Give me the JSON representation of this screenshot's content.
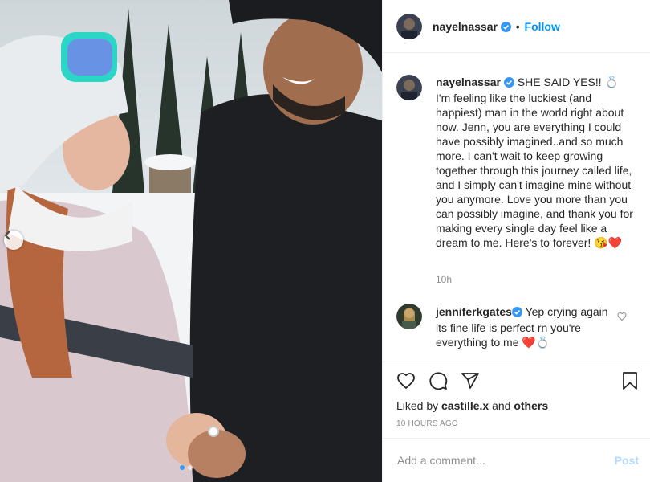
{
  "post": {
    "author": "nayelnassar",
    "follow_label": "Follow",
    "separator": "•",
    "caption": "SHE SAID YES!! 💍 I'm feeling like the luckiest (and happiest) man in the world right about now. Jenn, you are everything I could have possibly imagined..and so much more. I can't wait to keep growing together through this journey called life, and I simply can't imagine mine without you anymore. Love you more than you can possibly imagine, and thank you for making every single day feel like a dream to me. Here's to forever! 😘❤️",
    "time_ago": "10h"
  },
  "comment": {
    "author": "jenniferkgates",
    "text": "Yep crying again its fine life is perfect rn you're everything to me ❤️💍"
  },
  "likes": {
    "prefix": "Liked by",
    "user": "castille.x",
    "and": "and",
    "others": "others"
  },
  "timestamp": "10 HOURS AGO",
  "comment_box": {
    "placeholder": "Add a comment...",
    "post_label": "Post"
  },
  "carousel": {
    "slide_count": 2,
    "active_index": 0
  },
  "colors": {
    "accent": "#0095f6",
    "verified": "#3897f0",
    "muted": "#8e8e8e",
    "post_disabled": "#b3dbff"
  },
  "icons": [
    "chevron-left-icon",
    "verified-badge-icon",
    "heart-icon",
    "comment-icon",
    "share-icon",
    "bookmark-icon"
  ]
}
